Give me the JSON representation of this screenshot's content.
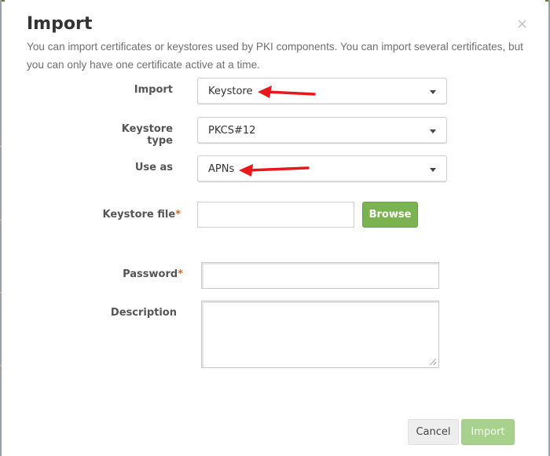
{
  "dialog": {
    "title": "Import",
    "close_glyph": "×",
    "description": "You can import certificates or keystores used by PKI components. You can import several certificates, but you can only have one certificate active at a time."
  },
  "form": {
    "import": {
      "label": "Import",
      "value": "Keystore"
    },
    "keystore_type": {
      "label": "Keystore type",
      "value": "PKCS#12"
    },
    "use_as": {
      "label": "Use as",
      "value": "APNs"
    },
    "keystore_file": {
      "label": "Keystore file",
      "required_mark": "*",
      "value": "",
      "browse_label": "Browse"
    },
    "password": {
      "label": "Password",
      "required_mark": "*",
      "value": ""
    },
    "description": {
      "label": "Description",
      "value": ""
    }
  },
  "footer": {
    "cancel_label": "Cancel",
    "import_label": "Import"
  },
  "colors": {
    "accent_green": "#7ab34f",
    "disabled_green": "#a9d18e",
    "annotation_arrow": "#e8171b",
    "required_mark": "#d46a1f"
  }
}
